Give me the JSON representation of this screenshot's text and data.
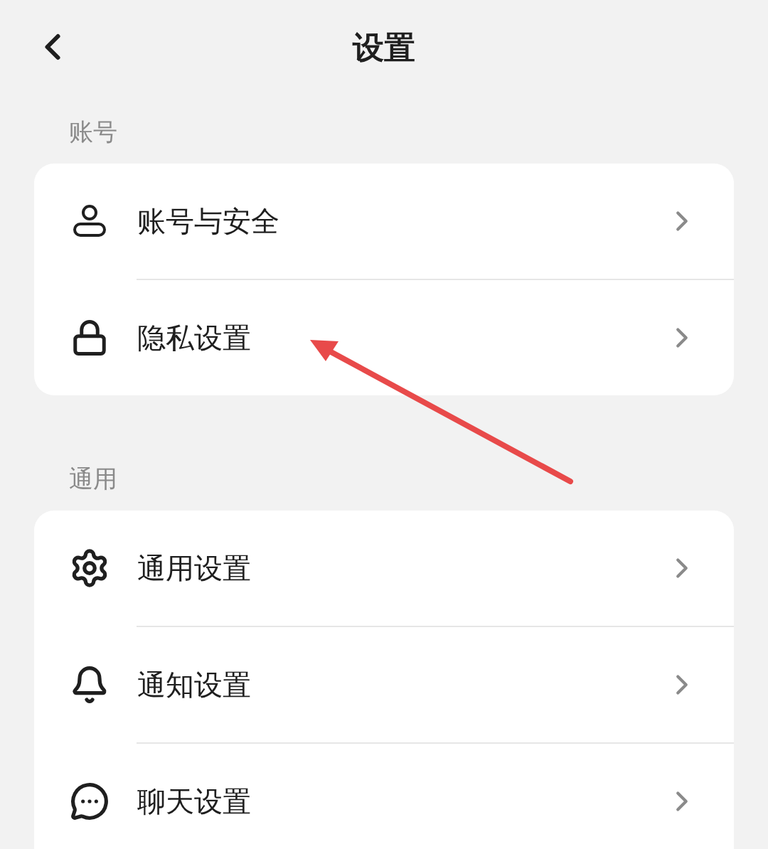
{
  "header": {
    "title": "设置"
  },
  "sections": [
    {
      "label": "账号",
      "more_below": false,
      "items": [
        {
          "label": "账号与安全"
        },
        {
          "label": "隐私设置"
        }
      ]
    },
    {
      "label": "通用",
      "more_below": true,
      "items": [
        {
          "label": "通用设置"
        },
        {
          "label": "通知设置"
        },
        {
          "label": "聊天设置"
        }
      ]
    }
  ]
}
